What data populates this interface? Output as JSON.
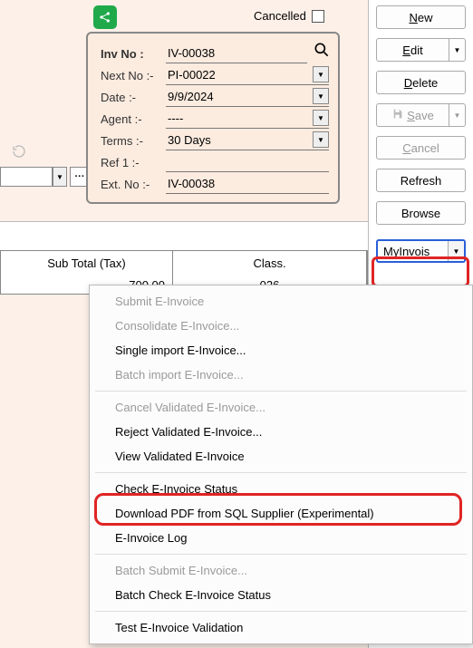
{
  "cancelled_label": "Cancelled",
  "info": {
    "inv_no_label": "Inv No :",
    "inv_no": "IV-00038",
    "next_no_label": "Next No :-",
    "next_no": "PI-00022",
    "date_label": "Date :-",
    "date": "9/9/2024",
    "agent_label": "Agent :-",
    "agent": "----",
    "terms_label": "Terms :-",
    "terms": "30 Days",
    "ref1_label": "Ref 1 :-",
    "ref1": "",
    "extno_label": "Ext. No :-",
    "extno": "IV-00038"
  },
  "buttons": {
    "new_pre": "",
    "new_key": "N",
    "new_post": "ew",
    "edit_pre": "",
    "edit_key": "E",
    "edit_post": "dit",
    "delete_pre": "",
    "delete_key": "D",
    "delete_post": "elete",
    "save_pre": "",
    "save_key": "S",
    "save_post": "ave",
    "cancel_pre": "",
    "cancel_key": "C",
    "cancel_post": "ancel",
    "refresh": "Refresh",
    "browse": "Browse",
    "myinvois": "MyInvois"
  },
  "table": {
    "col_subtotal": "Sub Total (Tax)",
    "col_class": "Class.",
    "row0_subtotal": "700.00",
    "row0_class": "026"
  },
  "menu": {
    "submit": "Submit E-Invoice",
    "consolidate": "Consolidate E-Invoice...",
    "single_import": "Single import E-Invoice...",
    "batch_import": "Batch import E-Invoice...",
    "cancel_validated": "Cancel Validated E-Invoice...",
    "reject_validated": "Reject Validated E-Invoice...",
    "view_validated": "View Validated E-Invoice",
    "check_status": "Check E-Invoice Status",
    "download_pdf": "Download PDF from SQL Supplier (Experimental)",
    "einvoice_log": "E-Invoice Log",
    "batch_submit": "Batch Submit E-Invoice...",
    "batch_check": "Batch Check E-Invoice Status",
    "test_validation": "Test E-Invoice Validation"
  }
}
